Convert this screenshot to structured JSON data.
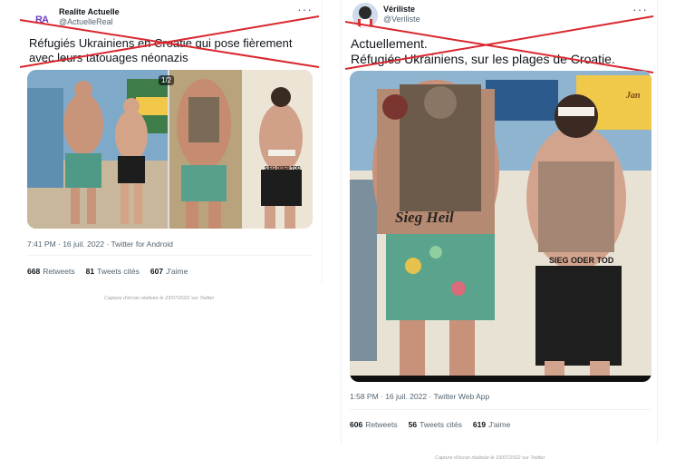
{
  "tweet_left": {
    "name": "Realite Actuelle",
    "handle": "@ActuelleReal",
    "avatar_text": "RA",
    "more": "···",
    "text": "Réfugiés Ukrainiens en Croatie qui pose fièrement avec leurs tatouages néonazis",
    "image_counter": "1/2",
    "image_caption": "SIEG ODER TOD",
    "meta": "7:41 PM · 16 juil. 2022 · Twitter for Android",
    "retweets_value": "668",
    "retweets_label": "Retweets",
    "quotes_value": "81",
    "quotes_label": "Tweets cités",
    "likes_value": "607",
    "likes_label": "J'aime",
    "caption": "Capture d'écran réalisée le 23/07/2022 sur Twitter"
  },
  "tweet_right": {
    "name": "Vériliste",
    "handle": "@Veriliste",
    "more": "···",
    "text_line1": "Actuellement.",
    "text_line2": "Réfugiés Ukrainiens, sur les plages de Croatie.",
    "tattoo_text1": "Sieg Heil",
    "tattoo_text2": "SIEG ODER TOD",
    "umbrella_text": "Jan",
    "meta": "1:58 PM · 16 juil. 2022 · Twitter Web App",
    "retweets_value": "606",
    "retweets_label": "Retweets",
    "quotes_value": "56",
    "quotes_label": "Tweets cités",
    "likes_value": "619",
    "likes_label": "J'aime",
    "caption": "Capture d'écran réalisée le 23/07/2022 sur Twitter"
  },
  "colors": {
    "strike": "#d9272e",
    "secondary_text": "#536471"
  }
}
